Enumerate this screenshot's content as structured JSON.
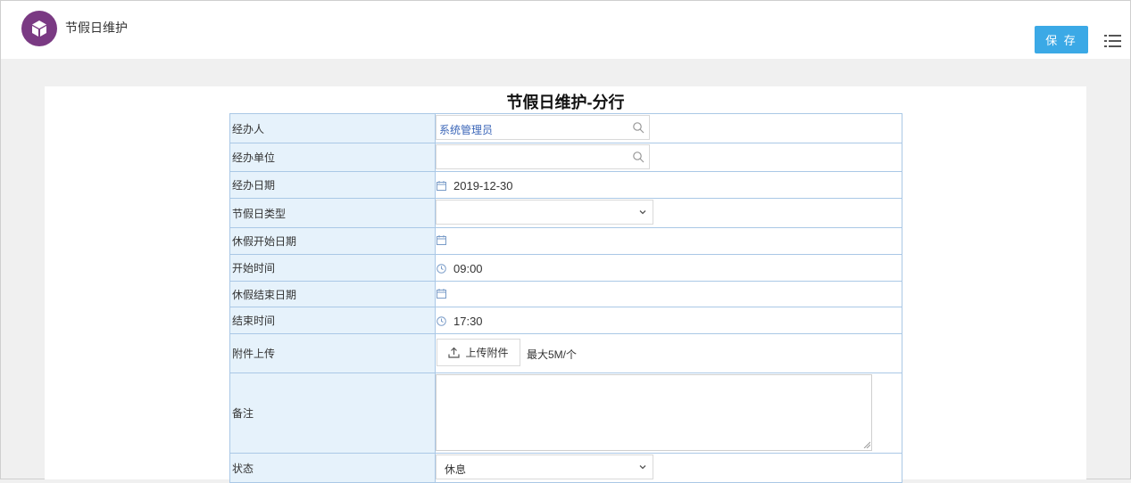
{
  "header": {
    "app_title": "节假日维护",
    "save_label": "保 存"
  },
  "form": {
    "title": "节假日维护-分行",
    "fields": {
      "handler": {
        "label": "经办人",
        "value": "系统管理员"
      },
      "unit": {
        "label": "经办单位",
        "value": ""
      },
      "date": {
        "label": "经办日期",
        "value": "2019-12-30"
      },
      "holiday_type": {
        "label": "节假日类型",
        "value": ""
      },
      "start_date": {
        "label": "休假开始日期",
        "value": ""
      },
      "start_time": {
        "label": "开始时间",
        "value": "09:00"
      },
      "end_date": {
        "label": "休假结束日期",
        "value": ""
      },
      "end_time": {
        "label": "结束时间",
        "value": "17:30"
      },
      "attachment": {
        "label": "附件上传",
        "button": "上传附件",
        "hint": "最大5M/个"
      },
      "remarks": {
        "label": "备注",
        "value": ""
      },
      "status": {
        "label": "状态",
        "value": "休息"
      }
    }
  },
  "colors": {
    "accent": "#3ba9e6",
    "logo": "#7a3a83",
    "label_bg": "#e6f2fb",
    "border": "#aac8e6"
  }
}
